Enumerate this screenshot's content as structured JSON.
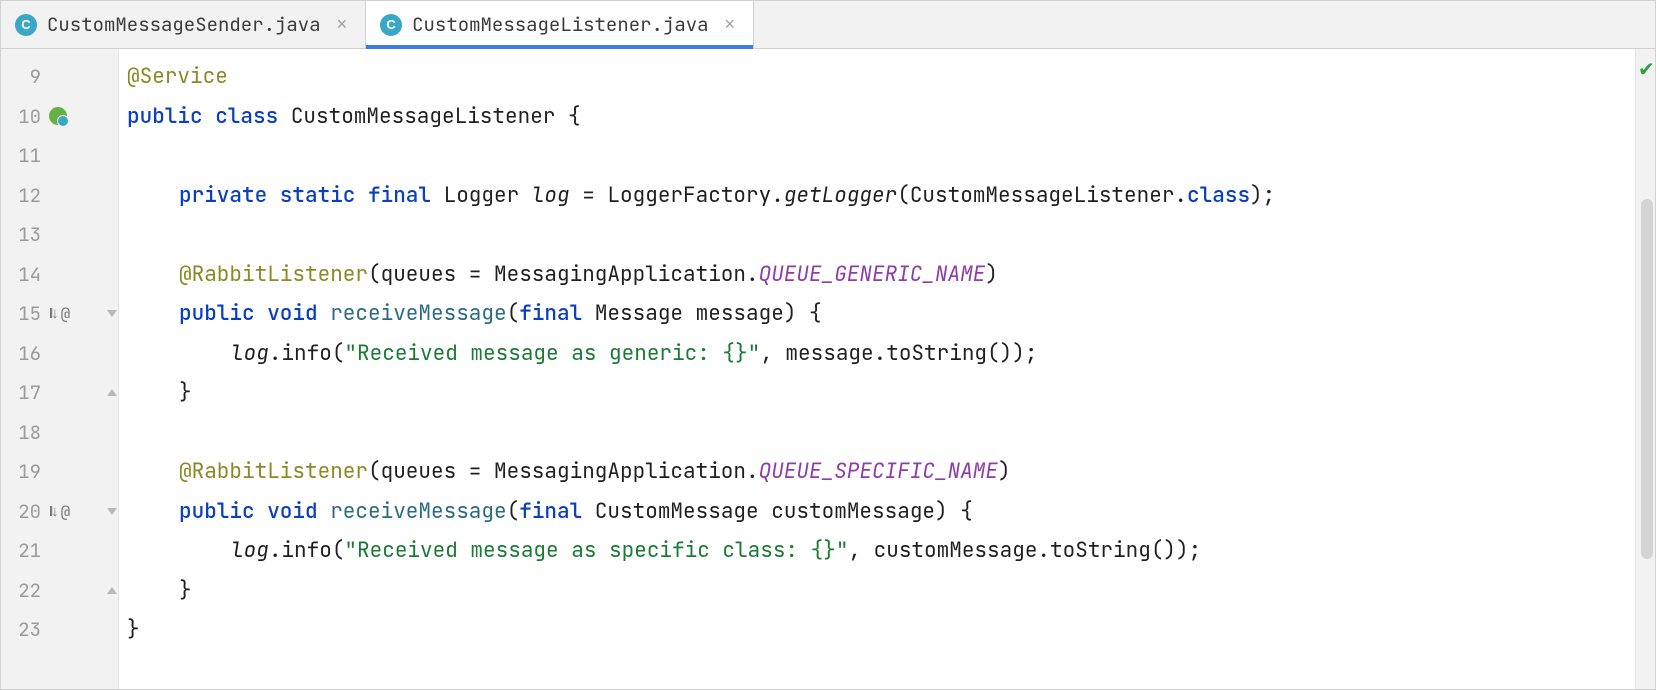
{
  "tabs": [
    {
      "label": "CustomMessageSender.java",
      "active": false
    },
    {
      "label": "CustomMessageListener.java",
      "active": true
    }
  ],
  "gutter": {
    "lines": [
      "9",
      "10",
      "11",
      "12",
      "13",
      "14",
      "15",
      "16",
      "17",
      "18",
      "19",
      "20",
      "21",
      "22",
      "23"
    ]
  },
  "code": {
    "l9": {
      "anno": "@Service"
    },
    "l10": {
      "k1": "public class ",
      "name": "CustomMessageListener",
      "brace": " {"
    },
    "l12": {
      "k1": "private static final ",
      "type": "Logger ",
      "var": "log",
      "eq": " = LoggerFactory.",
      "m": "getLogger",
      "rest": "(CustomMessageListener.",
      "kclass": "class",
      "end": ");"
    },
    "l14": {
      "anno": "@RabbitListener",
      "open": "(queues = MessagingApplication.",
      "const": "QUEUE_GENERIC_NAME",
      "close": ")"
    },
    "l15": {
      "k1": "public void ",
      "m": "receiveMessage",
      "open": "(",
      "kfinal": "final ",
      "param": "Message message) {"
    },
    "l16": {
      "var": "log",
      "call": ".info(",
      "str": "\"Received message as generic: {}\"",
      "rest": ", message.toString());"
    },
    "l17": {
      "brace": "}"
    },
    "l19": {
      "anno": "@RabbitListener",
      "open": "(queues = MessagingApplication.",
      "const": "QUEUE_SPECIFIC_NAME",
      "close": ")"
    },
    "l20": {
      "k1": "public void ",
      "m": "receiveMessage",
      "open": "(",
      "kfinal": "final ",
      "param": "CustomMessage customMessage) {"
    },
    "l21": {
      "var": "log",
      "call": ".info(",
      "str": "\"Received message as specific class: {}\"",
      "rest": ", customMessage.toString());"
    },
    "l22": {
      "brace": "}"
    },
    "l23": {
      "brace": "}"
    }
  },
  "rail": {
    "status": "ok"
  }
}
